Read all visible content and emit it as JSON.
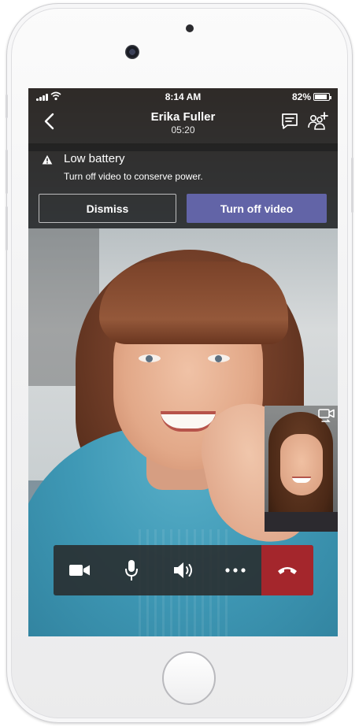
{
  "status_bar": {
    "time": "8:14 AM",
    "battery_percent": "82%"
  },
  "call": {
    "caller_name": "Erika Fuller",
    "duration": "05:20"
  },
  "banner": {
    "title": "Low battery",
    "message": "Turn off video to conserve power.",
    "dismiss_label": "Dismiss",
    "turn_off_label": "Turn off video"
  },
  "icons": {
    "back": "chevron-left-icon",
    "chat": "chat-icon",
    "add_people": "add-people-icon",
    "warning": "warning-icon",
    "switch_camera": "switch-camera-icon",
    "video": "video-camera-icon",
    "mic": "microphone-icon",
    "speaker": "speaker-icon",
    "more": "more-icon",
    "hangup": "hang-up-icon"
  },
  "colors": {
    "accent": "#6264a7",
    "hangup": "#a4262c",
    "overlay": "#1e1e1e"
  }
}
